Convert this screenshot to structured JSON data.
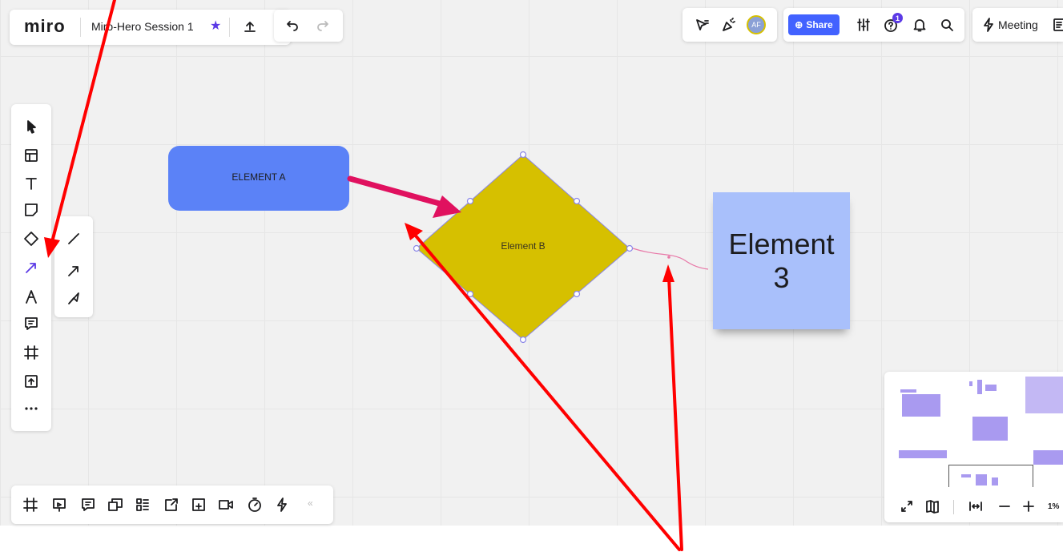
{
  "topbar": {
    "logo": "miro",
    "board_title": "Miro-Hero Session 1",
    "avatar_initials": "AF",
    "share_label": "Share",
    "help_badge": "1",
    "meeting_label": "Meeting"
  },
  "board": {
    "element_a": "ELEMENT A",
    "element_b": "Element B",
    "sticky_line1": "Element",
    "sticky_line2": "3"
  },
  "minimap": {
    "zoom_label": "1%"
  },
  "colors": {
    "accent": "#4262ff",
    "element_a_fill": "#5b82f7",
    "element_b_fill": "#d6c000",
    "sticky_fill": "#a9c0fb",
    "connector": "#e0115f",
    "annotation": "#ff0000",
    "tool_active": "#5b3ae6"
  },
  "icons": {
    "toolbar": [
      "cursor-icon",
      "template-icon",
      "text-icon",
      "sticky-note-icon",
      "shapes-icon",
      "arrow-tool-icon",
      "pen-icon",
      "comment-icon",
      "frame-icon",
      "upload-icon",
      "more-icon"
    ],
    "line_submenu": [
      "straight-line-icon",
      "arrow-line-icon",
      "elbow-line-icon"
    ],
    "bottombar": [
      "frames-icon",
      "presentation-icon",
      "comments-icon",
      "cards-icon",
      "kanban-icon",
      "export-icon",
      "embed-icon",
      "video-icon",
      "timer-icon",
      "activity-icon",
      "collapse-icon"
    ],
    "topright": [
      "reactions-icon",
      "celebrate-icon",
      "avatar",
      "share-globe-icon",
      "settings-sliders-icon",
      "help-icon",
      "bell-icon",
      "search-icon",
      "lightning-icon",
      "notes-icon"
    ]
  }
}
